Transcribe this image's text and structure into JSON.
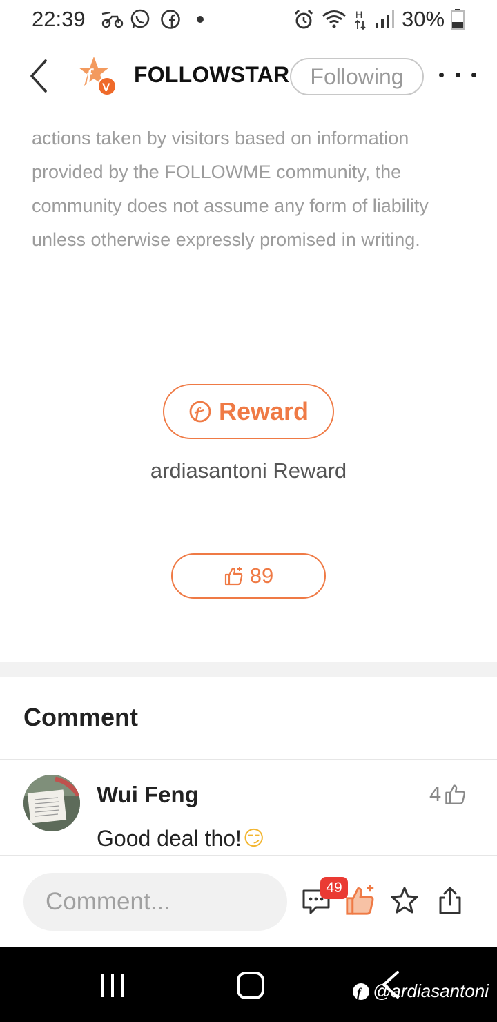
{
  "status_bar": {
    "time": "22:39",
    "icons": [
      "moped-icon",
      "whatsapp-icon",
      "facebook-icon",
      "dot-icon",
      "alarm-icon",
      "wifi-icon",
      "hplus-icon",
      "signal-icon",
      "battery-icon"
    ],
    "battery": "30%"
  },
  "header": {
    "author": "FOLLOWSTAR",
    "follow_label": "Following"
  },
  "disclaimer": "actions taken by visitors based on information provided by the FOLLOWME community, the community does not assume any form of liability unless otherwise expressly promised in writing.",
  "reward": {
    "button_label": "Reward",
    "caption": "ardiasantoni Reward"
  },
  "likes": {
    "count": "89"
  },
  "comments": {
    "title": "Comment",
    "items": [
      {
        "user": "Wui Feng",
        "text": "Good deal tho!",
        "emoji": "😏",
        "likes": "4"
      }
    ]
  },
  "bottom_bar": {
    "placeholder": "Comment...",
    "comment_count": "49"
  },
  "watermark": "@ardiasantoni",
  "colors": {
    "accent": "#ef7a45",
    "badge": "#ea3a33",
    "text_muted": "#9c9c9c"
  }
}
